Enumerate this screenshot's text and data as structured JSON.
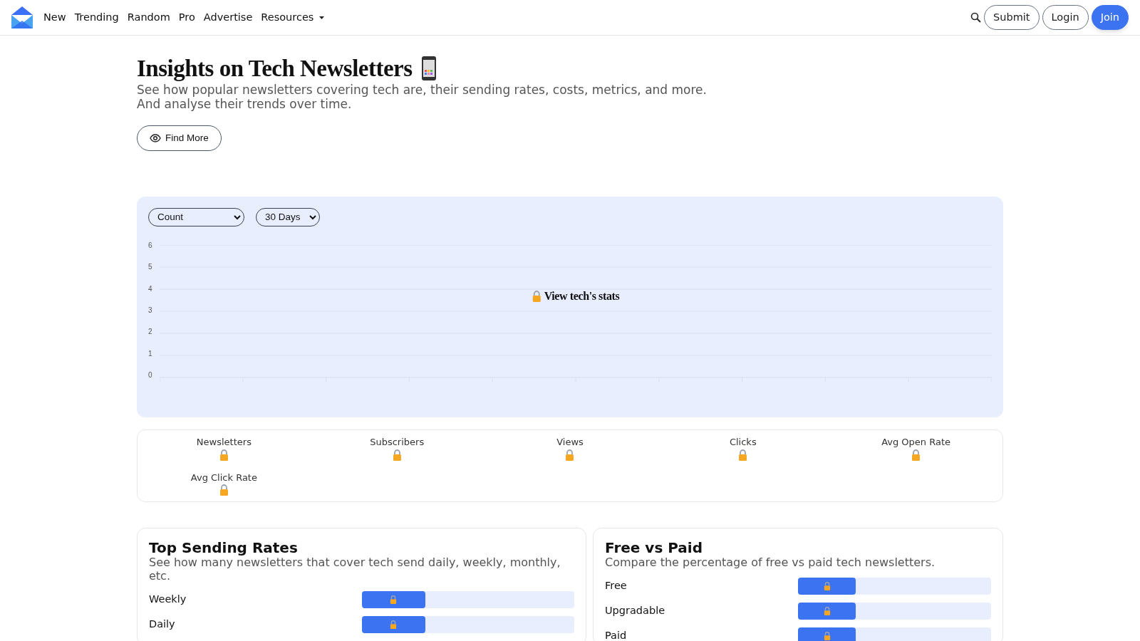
{
  "nav": {
    "links": [
      "New",
      "Trending",
      "Random",
      "Pro",
      "Advertise"
    ],
    "menu": "Resources",
    "buttons": [
      {
        "label": "Submit",
        "kind": "outline"
      },
      {
        "label": "Login",
        "kind": "outline"
      },
      {
        "label": "Join",
        "kind": "primary"
      }
    ]
  },
  "hero": {
    "title": "Insights on Tech Newsletters",
    "subtitle_lines": [
      "See how popular newsletters covering tech are, their sending rates, costs, metrics, and more.",
      "And analyse their trends over time."
    ],
    "button": "Find More"
  },
  "chart": {
    "selects": [
      "Count",
      "30 Days"
    ],
    "yticks": [
      "6",
      "5",
      "4",
      "3",
      "2",
      "1",
      "0"
    ],
    "overlay": "View tech's stats"
  },
  "stats": [
    "Newsletters",
    "Subscribers",
    "Views",
    "Clicks",
    "Avg Open Rate",
    "Avg Click Rate"
  ],
  "cards": [
    {
      "title": "Top Sending Rates",
      "description": "See how many newsletters that cover tech send daily, weekly, monthly, etc.",
      "rows": [
        {
          "label": "Weekly",
          "level": 0.3
        },
        {
          "label": "Daily",
          "level": 0.3
        }
      ]
    },
    {
      "title": "Free vs Paid",
      "description": "Compare the percentage of free vs paid tech newsletters.",
      "rows": [
        {
          "label": "Free",
          "level": 0.3
        },
        {
          "label": "Upgradable",
          "level": 0.3
        },
        {
          "label": "Paid",
          "level": 0.3
        }
      ]
    }
  ]
}
